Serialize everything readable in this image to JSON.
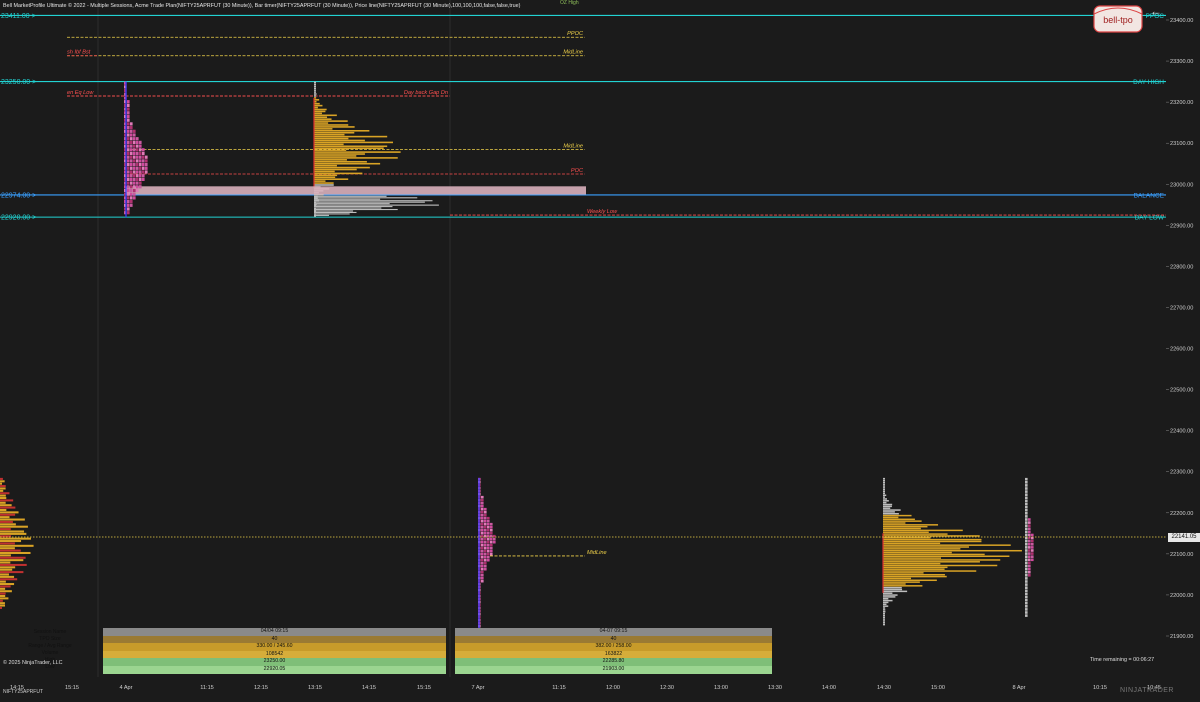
{
  "header": {
    "title": "Bell MarketProfile Ultimate © 2022 - Multiple Sessions, Acme Trade Plan(NIFTY25APRFUT (30 Minute)), Bar timer(NIFTY25APRFUT (30 Minute)), Price line(NIFTY25APRFUT (30 Minute),100,100,100,false,false,true)",
    "top_right_note": "OZ High"
  },
  "logo_text": "bell-tpo",
  "back_icon": "arrow-left-icon",
  "levels_left": [
    {
      "text": "23411.00 >",
      "price": 23411,
      "color": "#22d3d3"
    },
    {
      "text": "23250.00 >",
      "price": 23250,
      "color": "#22d3d3"
    },
    {
      "text": "22974.00 >",
      "price": 22974,
      "color": "#3aa0ff"
    },
    {
      "text": "22920.00 >",
      "price": 22920,
      "color": "#22d3d3"
    }
  ],
  "levels_right": [
    {
      "text": "PPOC",
      "price": 23411,
      "color": "#22d3d3"
    },
    {
      "text": "DAY HIGH",
      "price": 23250,
      "color": "#22d3d3"
    },
    {
      "text": "BALANCE",
      "price": 22974,
      "color": "#3aa0ff"
    },
    {
      "text": "DAY LOW",
      "price": 22920,
      "color": "#22d3d3"
    }
  ],
  "annotations": [
    {
      "text": "PPOC",
      "price": 23358,
      "color": "#f0d24a"
    },
    {
      "text": "MidLine",
      "price": 23313,
      "color": "#f0d24a"
    },
    {
      "text": "sh Ibf Bst",
      "price": 23313,
      "color": "#ff5050"
    },
    {
      "text": "en Eq Low",
      "price": 23215,
      "color": "#ff5050"
    },
    {
      "text": "Day back Gap Dn",
      "price": 23215,
      "color": "#ff5050"
    },
    {
      "text": "MidLine",
      "price": 23085,
      "color": "#f0d24a"
    },
    {
      "text": "POC",
      "price": 23025,
      "color": "#ff5050"
    },
    {
      "text": "Weekly Low",
      "price": 22925,
      "color": "#ff5050"
    },
    {
      "text": "MidLine",
      "price": 22095,
      "color": "#f0d24a"
    }
  ],
  "last_price": "22141.05",
  "stats_row_labels": [
    "Session Name",
    "TPO Size",
    "Range / Avg Range",
    "Volume",
    "High",
    "Low"
  ],
  "sessions": [
    {
      "session": "04/04 09:15",
      "tpo_size": "40",
      "range": "330.00 / 245.60",
      "volume": "108542",
      "high": "23250.00",
      "low": "22920.05"
    },
    {
      "session": "04-07 09:15",
      "tpo_size": "40",
      "range": "382.00 / 258.00",
      "volume": "163822",
      "high": "22285.80",
      "low": "21903.00"
    }
  ],
  "copyright": "© 2025 NinjaTrader, LLC",
  "time_remaining": "Time remaining = 00:06:27",
  "symbol": "NIFTY25APRFUT",
  "brand": "NINJATRADER",
  "chart_data": {
    "type": "market-profile",
    "y_axis": {
      "min": 21875,
      "max": 23425,
      "ticks": [
        21900,
        22000,
        22100,
        22200,
        22300,
        22400,
        22500,
        22600,
        22700,
        22800,
        22900,
        23000,
        23100,
        23200,
        23300,
        23400
      ]
    },
    "x_ticks": [
      "14:15",
      "15:15",
      "4 Apr",
      "11:15",
      "12:15",
      "13:15",
      "14:15",
      "15:15",
      "7 Apr",
      "11:15",
      "12:00",
      "12:30",
      "13:00",
      "13:30",
      "14:00",
      "14:30",
      "15:00",
      "8 Apr",
      "10:15",
      "10:45"
    ],
    "profiles": [
      {
        "session": "04/04",
        "high": 23250,
        "low": 22920,
        "poc": 23025,
        "midline": 23085
      },
      {
        "session": "04/07",
        "high": 22285,
        "low": 21903,
        "midline": 22095
      },
      {
        "session": "04/08",
        "high": 22285,
        "low": 21925,
        "poc": 22141.05
      }
    ],
    "last_price": 22141.05
  },
  "colors": {
    "background": "#1b1b1b",
    "level_line": "#22d3d3",
    "balance_line": "#3aa0ff",
    "gold_profile": "#d9a325",
    "grey_profile": "#bdbdbd",
    "magenta_tpo": "#d04a9e",
    "red_annotation": "#ff5050",
    "yellow_annotation": "#f0d24a"
  }
}
